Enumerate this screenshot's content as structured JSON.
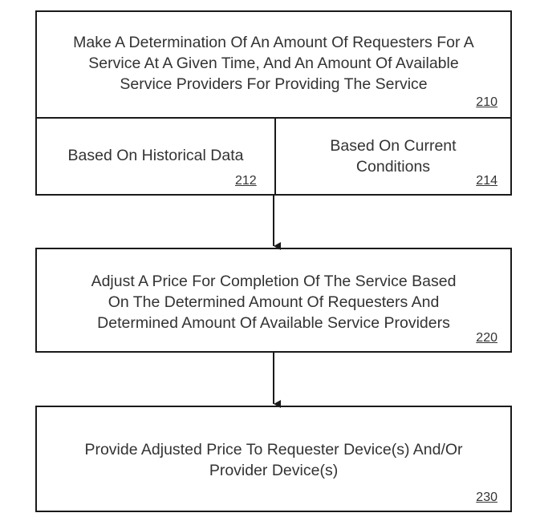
{
  "steps": {
    "s210": {
      "text": "Make A Determination Of An Amount Of Requesters For A\nService At A Given Time, And An Amount Of Available\nService Providers For Providing The Service",
      "ref": "210"
    },
    "s212": {
      "text": "Based On Historical Data",
      "ref": "212"
    },
    "s214": {
      "text": "Based On Current\nConditions",
      "ref": "214"
    },
    "s220": {
      "text": "Adjust A Price For Completion Of The Service Based\nOn The Determined Amount Of Requesters And\nDetermined Amount  Of Available Service Providers",
      "ref": "220"
    },
    "s230": {
      "text": "Provide Adjusted Price To Requester Device(s) And/Or\nProvider Device(s)",
      "ref": "230"
    }
  }
}
